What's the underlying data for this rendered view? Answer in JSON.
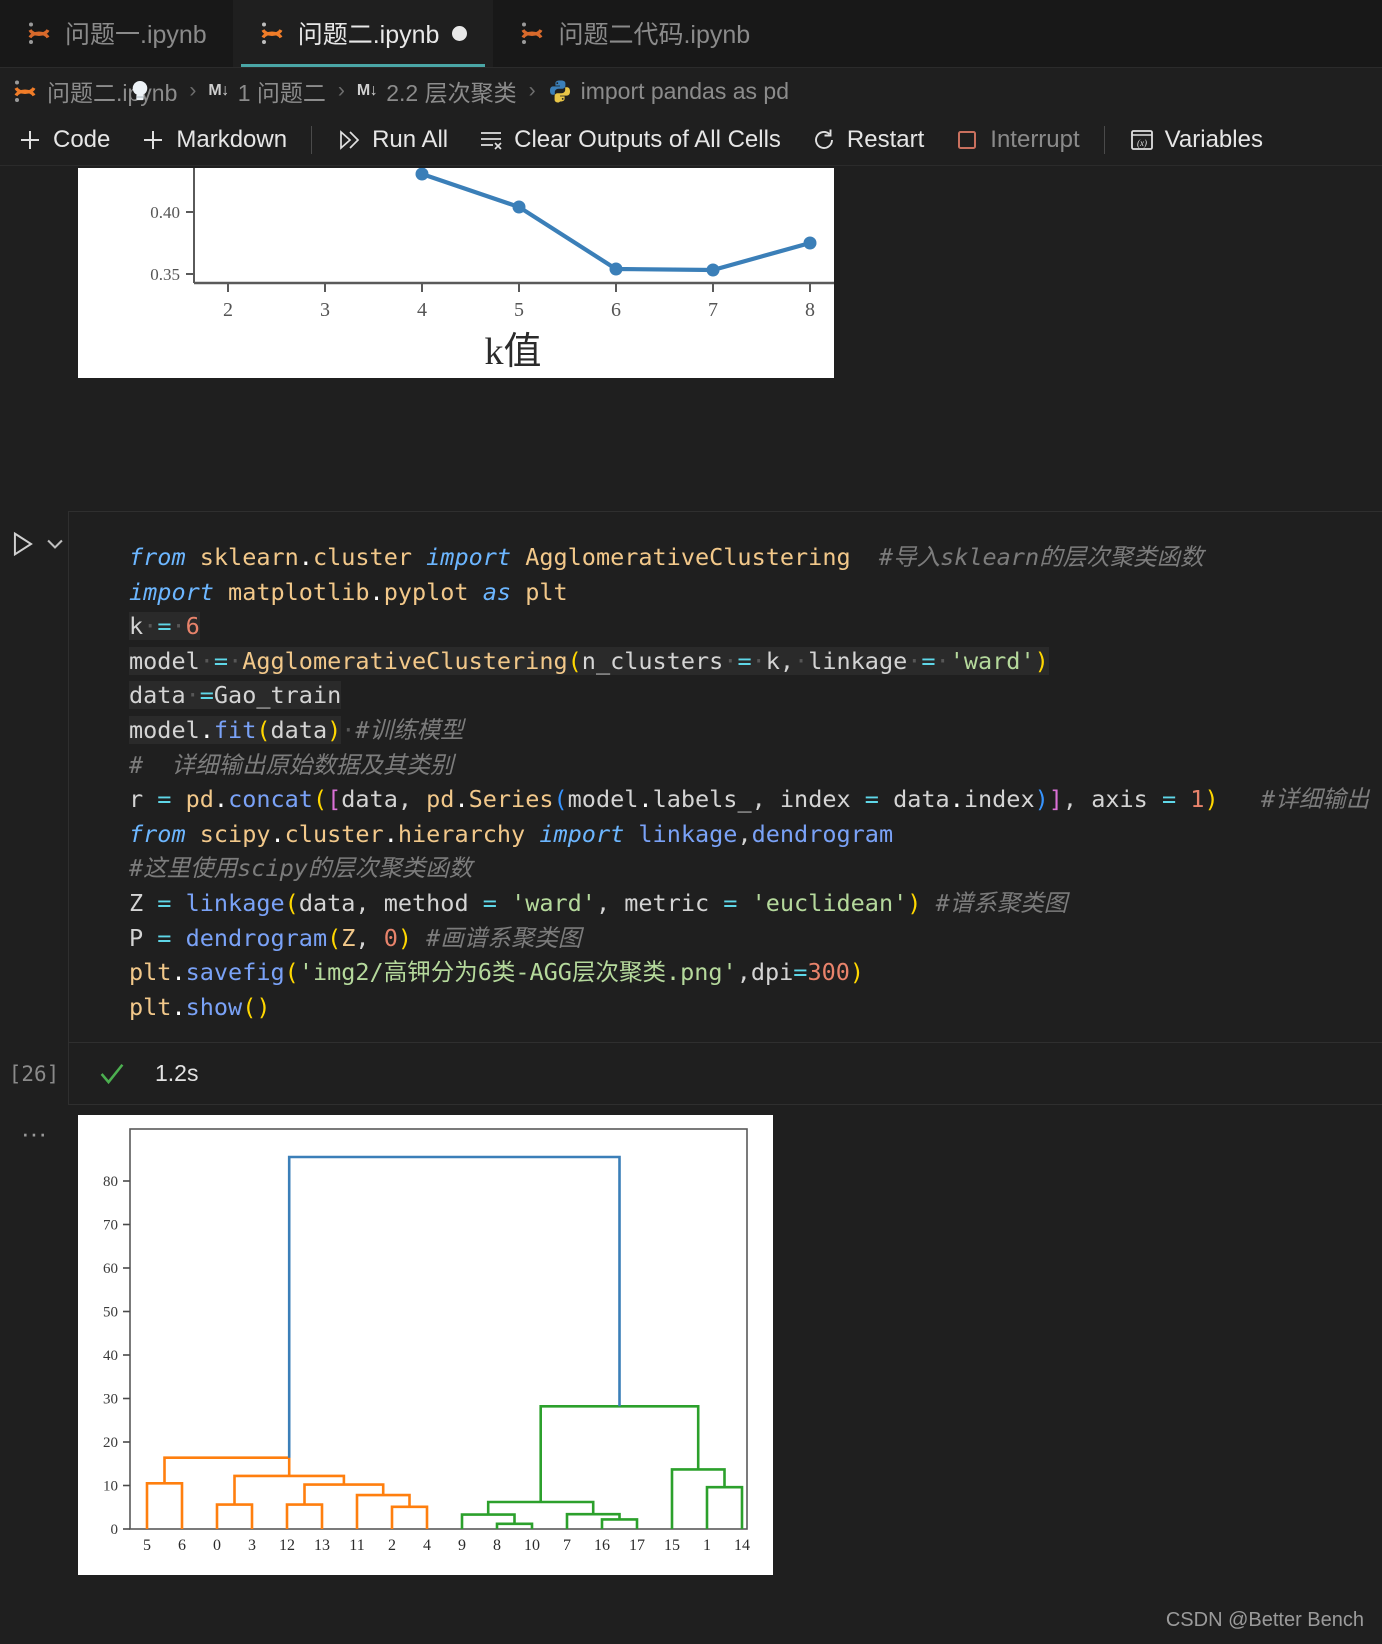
{
  "tabs": [
    {
      "label": "问题一.ipynb",
      "icon": "jupyter-icon",
      "active": false,
      "dirty": false
    },
    {
      "label": "问题二.ipynb",
      "icon": "jupyter-icon",
      "active": true,
      "dirty": true
    },
    {
      "label": "问题二代码.ipynb",
      "icon": "jupyter-icon",
      "active": false,
      "dirty": false
    }
  ],
  "breadcrumb": {
    "items": [
      {
        "label": "问题二.ipynb",
        "icon": "jupyter-icon"
      },
      {
        "label": "1 问题二",
        "badge": "M↓"
      },
      {
        "label": "2.2 层次聚类",
        "badge": "M↓"
      },
      {
        "label": "import pandas as pd",
        "icon": "python-icon"
      }
    ],
    "separator": "›"
  },
  "toolbar": {
    "add_code": "Code",
    "add_markdown": "Markdown",
    "run_all": "Run All",
    "clear_outputs": "Clear Outputs of All Cells",
    "restart": "Restart",
    "interrupt": "Interrupt",
    "variables": "Variables"
  },
  "cell": {
    "execution_count": "[26]",
    "duration": "1.2s",
    "status": "success",
    "overflow_menu": "···",
    "code_lines": [
      "from sklearn.cluster import AgglomerativeClustering  #导入sklearn的层次聚类函数",
      "import matplotlib.pyplot as plt",
      "k = 6",
      "model = AgglomerativeClustering(n_clusters = k, linkage = 'ward')",
      "data =Gao_train",
      "model.fit(data) #训练模型",
      "#  详细输出原始数据及其类别",
      "r = pd.concat([data, pd.Series(model.labels_, index = data.index)], axis = 1)   #详细输出",
      "from scipy.cluster.hierarchy import linkage,dendrogram",
      "#这里使用scipy的层次聚类函数",
      "Z = linkage(data, method = 'ward', metric = 'euclidean') #谱系聚类图",
      "P = dendrogram(Z, 0) #画谱系聚类图",
      "plt.savefig('img2/高钾分为6类-AGG层次聚类.png',dpi=300)",
      "plt.show()"
    ]
  },
  "chart_data": [
    {
      "type": "line",
      "title": "",
      "xlabel": "k值",
      "ylabel": "",
      "x": [
        4,
        5,
        6,
        7,
        8
      ],
      "y": [
        0.432,
        0.406,
        0.354,
        0.353,
        0.374
      ],
      "xticks": [
        2,
        3,
        4,
        5,
        6,
        7,
        8
      ],
      "yticks": [
        0.35,
        0.4
      ],
      "ytick_labels": [
        "0.35",
        "0.40"
      ],
      "xlim": [
        1.6,
        8.4
      ],
      "ylim": [
        0.333,
        0.442
      ],
      "grid": false,
      "legend": "none",
      "color": "#3b7fb8",
      "note": "top plot is clipped by the viewport; only lower portion visible"
    },
    {
      "type": "dendrogram",
      "title": "",
      "xlabel": "",
      "ylabel": "",
      "yticks": [
        0,
        10,
        20,
        30,
        40,
        50,
        60,
        70,
        80
      ],
      "ylim": [
        0,
        92
      ],
      "leaf_labels": [
        "5",
        "6",
        "0",
        "3",
        "12",
        "13",
        "11",
        "2",
        "4",
        "9",
        "8",
        "10",
        "7",
        "16",
        "17",
        "15",
        "1",
        "14"
      ],
      "link_colors": {
        "root": "#3b7fb8",
        "cluster_a": "#ff7f0e",
        "cluster_b": "#2ca02c"
      },
      "merges": [
        {
          "left": "5",
          "right": "6",
          "height": 10.5,
          "color": "#ff7f0e"
        },
        {
          "left": "0",
          "right": "3",
          "height": 5.6,
          "color": "#ff7f0e"
        },
        {
          "left": "12",
          "right": "13",
          "height": 5.6,
          "color": "#ff7f0e"
        },
        {
          "left": "2",
          "right": "4",
          "height": 5.1,
          "color": "#ff7f0e"
        },
        {
          "left": "11",
          "right": "(2,4)",
          "height": 7.8,
          "color": "#ff7f0e"
        },
        {
          "left": "(12,13)",
          "right": "(11,2,4)",
          "height": 10.2,
          "color": "#ff7f0e"
        },
        {
          "left": "(0,3)",
          "right": "(12,13,11,2,4)",
          "height": 12.2,
          "color": "#ff7f0e"
        },
        {
          "left": "(5,6)",
          "right": "rest-orange",
          "height": 16.4,
          "color": "#ff7f0e"
        },
        {
          "left": "8",
          "right": "10",
          "height": 1.2,
          "color": "#2ca02c"
        },
        {
          "left": "9",
          "right": "(8,10)",
          "height": 3.3,
          "color": "#2ca02c"
        },
        {
          "left": "16",
          "right": "17",
          "height": 2.2,
          "color": "#2ca02c"
        },
        {
          "left": "7",
          "right": "(16,17)",
          "height": 3.4,
          "color": "#2ca02c"
        },
        {
          "left": "(9,8,10)",
          "right": "(7,16,17)",
          "height": 6.2,
          "color": "#2ca02c"
        },
        {
          "left": "1",
          "right": "14",
          "height": 9.6,
          "color": "#2ca02c"
        },
        {
          "left": "15",
          "right": "(1,14)",
          "height": 13.7,
          "color": "#2ca02c"
        },
        {
          "left": "green-left",
          "right": "green-right",
          "height": 28.2,
          "color": "#2ca02c"
        },
        {
          "left": "orange-root",
          "right": "green-root",
          "height": 85.5,
          "color": "#3b7fb8"
        }
      ]
    }
  ],
  "watermark": "CSDN @Better Bench"
}
